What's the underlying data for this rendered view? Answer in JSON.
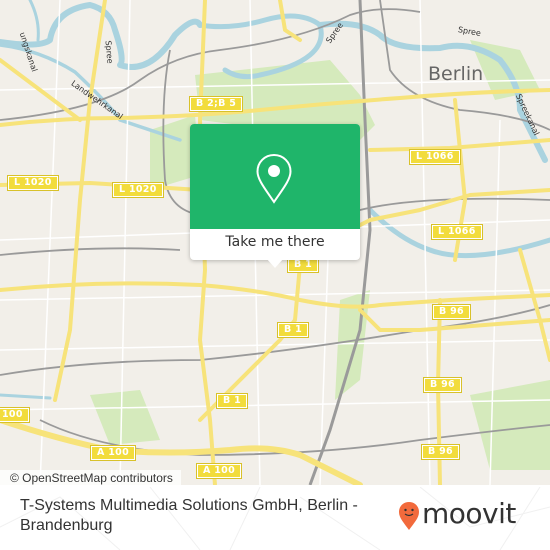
{
  "map": {
    "city_label": "Berlin",
    "water_labels": [
      {
        "id": "spree-left",
        "text": "Spree"
      },
      {
        "id": "spree-top",
        "text": "Spree"
      },
      {
        "id": "spree-right",
        "text": "Spree"
      },
      {
        "id": "landwehrkanal",
        "text": "Landwehrkanal"
      },
      {
        "id": "verbindungskanal",
        "text": "ungskanal"
      },
      {
        "id": "spreekanal",
        "text": "Spreekanal"
      }
    ],
    "road_shields": [
      {
        "id": "b2-b5",
        "text": "B 2;B 5"
      },
      {
        "id": "l1020-left",
        "text": "L 1020"
      },
      {
        "id": "l1020-mid",
        "text": "L 1020"
      },
      {
        "id": "l1066-top",
        "text": "L 1066"
      },
      {
        "id": "l1066-mid",
        "text": "L 1066"
      },
      {
        "id": "b1-top",
        "text": "B 1"
      },
      {
        "id": "b1-mid",
        "text": "B 1"
      },
      {
        "id": "b1-low",
        "text": "B 1"
      },
      {
        "id": "b96-top",
        "text": "B 96"
      },
      {
        "id": "b96-mid",
        "text": "B 96"
      },
      {
        "id": "b96-low",
        "text": "B 96"
      },
      {
        "id": "a100-left",
        "text": "A 100"
      },
      {
        "id": "a100-bottom",
        "text": "A 100"
      },
      {
        "id": "a100-edge",
        "text": "100"
      }
    ],
    "colors": {
      "land": "#f2efe9",
      "park": "#cfe8b0",
      "water": "#aad3df",
      "road": "#f7e37a",
      "rail": "#999999"
    },
    "attribution": "© OpenStreetMap contributors"
  },
  "popup": {
    "icon": "map-pin-icon",
    "button_label": "Take me there",
    "color": "#1fb56a"
  },
  "footer": {
    "place_name": "T-Systems Multimedia Solutions GmbH, Berlin - Brandenburg",
    "brand": "moovit",
    "brand_color": "#f26a3c"
  }
}
